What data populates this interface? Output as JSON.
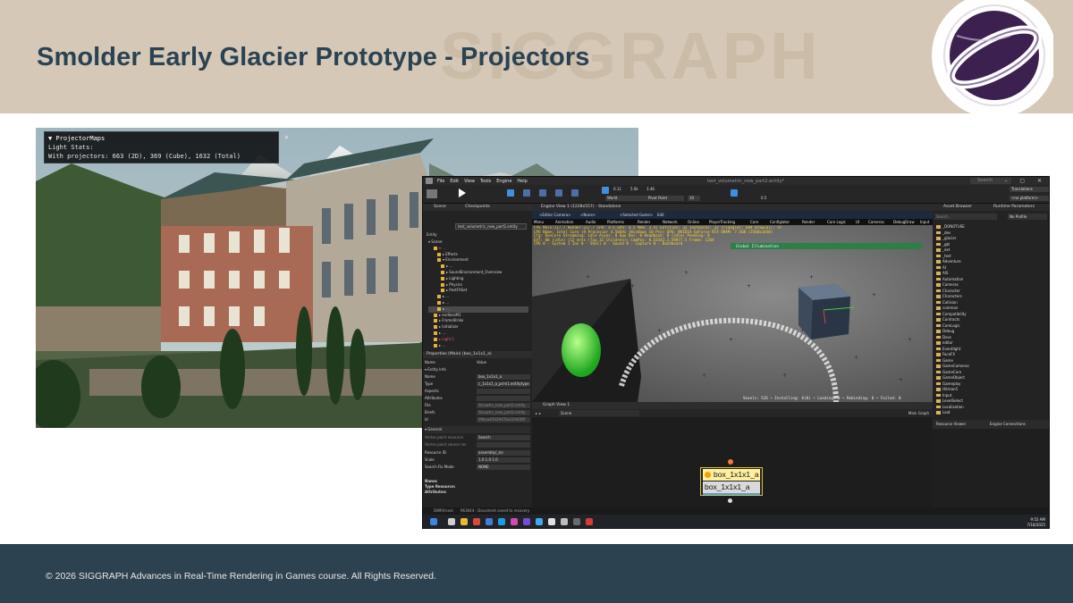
{
  "slide": {
    "watermark": "SIGGRAPH",
    "title": "Smolder Early Glacier Prototype - Projectors",
    "footer": "© 2026 SIGGRAPH Advances in Real-Time Rendering in Games course. All Rights Reserved."
  },
  "colors": {
    "header_bg": "#d5c8b6",
    "title_text": "#2b4252",
    "footer_bg": "#2d4250",
    "debug_text": "#ffd42a",
    "global_illum_bar": "#2d7e49"
  },
  "game_overlay": {
    "title": "▼ ProjectorMaps",
    "line1": "Light Stats:",
    "line2": "With projectors: 663 (2D), 369 (Cube), 1632 (Total)",
    "close": "✕"
  },
  "editor": {
    "menu": [
      "File",
      "Edit",
      "View",
      "Tools",
      "Engine",
      "Help"
    ],
    "window_title": "test_volumetric_new_part2.entity*",
    "search_placeholder": "Search",
    "window_buttons": "– ▢ ✕",
    "toolbar": {
      "val_a": "0.11",
      "val_b": "5.0k",
      "val_c": "3.46",
      "world": "World",
      "pivot": "Pivot Point",
      "num": "10",
      "translations": "Translations",
      "platform": "<no platform>",
      "lod": "0.5"
    },
    "scene_panel": {
      "tab1": "Scene",
      "tab2": "Checkpoints",
      "file": "test_volumetric_new_part2.entity",
      "entity_label": "Entity",
      "tree": [
        "▾ Scene",
        "▾ ...",
        "▸ Effects",
        "▾ Environment",
        "▸ ...",
        "▸ SoundEnvironment_Overview",
        "▸ Lighting",
        "▸ Physics",
        "▸ PostFXSet",
        "▸ ...",
        "▸ ...",
        "▸ ...",
        "▸ endlessM1",
        "▸ FrameStrike",
        "▸ Initializer",
        "▸ ...",
        "▸ Light 1",
        "▸ ..."
      ]
    },
    "properties": {
      "title": "Properties (Main) (box_1x1x1_a)",
      "col_name": "Name",
      "col_value": "Value",
      "section1": "▾ Entity Info",
      "rows": [
        {
          "k": "Name",
          "v": "box_1x1x1_a"
        },
        {
          "k": "Type",
          "v": "c_1x1x1_a_prim1.entitytype"
        },
        {
          "k": "Aspects",
          "v": ""
        },
        {
          "k": "Attributes",
          "v": ""
        },
        {
          "k": "File",
          "v": "/bcowhn_new_part2.entity"
        },
        {
          "k": "Briefs",
          "v": "/bcowhn_new_part2.entity"
        },
        {
          "k": "Id",
          "v": "09bca4593fef76e32940fff"
        }
      ],
      "section2": "▾ General",
      "rows2": [
        {
          "k": "Vertex paint resource",
          "v": "Search"
        },
        {
          "k": "Vertex paint source res",
          "v": ""
        },
        {
          "k": "Resource ID",
          "v": "assembly/_slv"
        },
        {
          "k": "Scale",
          "v": "1.0   1.0   1.0"
        },
        {
          "k": "Search Fix Mode",
          "v": "NONE"
        }
      ],
      "footer_name": "Name:",
      "footer_type": "Type Resource:",
      "footer_attr": "Attributes:"
    },
    "viewport": {
      "tab": "Engine View 1 (1228x557) - Standalone",
      "camera": "<Editor Camera>",
      "none": "<None>",
      "selected": "<Selected Game>",
      "edit": "Edit",
      "menu": [
        "Menu",
        "Animation",
        "Audio",
        "Platforms",
        "Render",
        "Network",
        "Online",
        "PlayerTracking",
        "Core",
        "Configlator",
        "Render",
        "Core Logic",
        "UI",
        "Cameras",
        "DebugDraw",
        "Input"
      ],
      "debug_lines": [
        "FPS Main:217.7 Render:217.7 CPU:   4.6  GPU:   4.5  Mem: 3.4l  Entities:    32 Instances:    32  Triangles:   694  Drawcall:   97",
        "CPU Name: Intel Core i9 Processor 4.50GHz  (Windows 10 Pro)  GPU: NVIDIA GeForce RTX   VRAM: 7.5GB (2560x1440)",
        "Cfg: DevCore   Streaming: idle   Async: 0   Gpu Dec: 0    Readback: 0 (idle)  Pending: 0",
        "EVT: 00  (idle)  (12 ents (Top 32 Children))  CamPos: 0.53342.2.59877.5  Frame: 1264",
        "CPU 0 - System 1   Inv 0 - Shell 0 - Sound 0 - Capture 0 - Dashboard"
      ],
      "global_illum": "Global Illumination",
      "bottom": "Voxels: 526 ~ Installing: 0(0) ~ Loading: 0 ~ Rebinding: 0 ~ Failed: 0"
    },
    "graph": {
      "tab": "Graph View 1",
      "scene": "Scene",
      "main_graph": "Main Graph",
      "node_title": "box_1x1x1_a",
      "node_field": "box_1x1x1_a"
    },
    "assets": {
      "tab1": "Asset Browser",
      "tab2": "Runtime Parameters",
      "profile": "No Profile",
      "search": "Search",
      "folders": [
        "_DONOTUSE",
        "_dev",
        "_glacier",
        "_gbl",
        "_ext",
        "_test",
        "Adventure",
        "AI",
        "AIS",
        "Automation",
        "Cameras",
        "Character",
        "Characters",
        "Collision",
        "common",
        "Compatibility",
        "Contracts",
        "CoreLogic",
        "Debug",
        "Devs",
        "editor",
        "Eventlight",
        "FaceFX",
        "Game",
        "GameCameras",
        "GameCore",
        "GameObject",
        "Gameplay",
        "Hitman5",
        "Input",
        "LevelSelect",
        "Localization",
        "Loot"
      ],
      "viewer": "Resource Viewer",
      "connections": "Engine Connections"
    },
    "statusbar": {
      "branch": "DWR/trunk",
      "msg": "963644 - Document saved to recovery"
    },
    "taskbar": {
      "time": "9:52 AM",
      "date": "7/18/2025"
    }
  }
}
